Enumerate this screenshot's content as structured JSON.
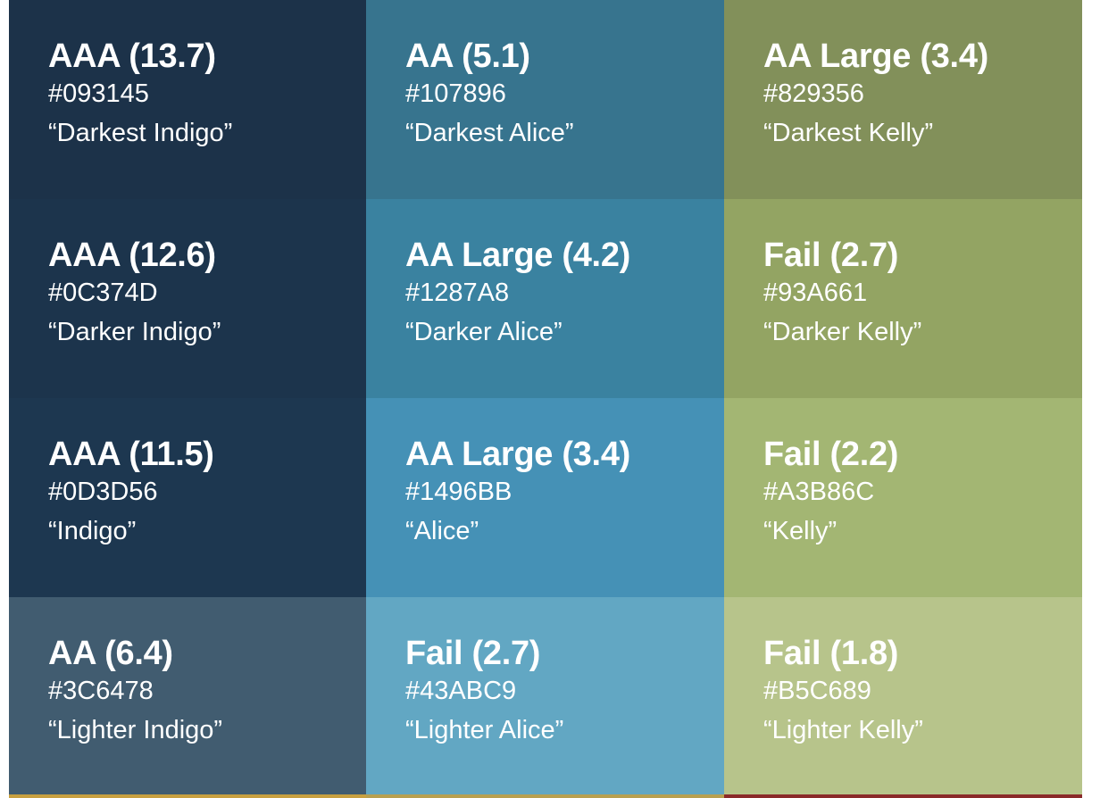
{
  "columns": [
    {
      "key": "indigo",
      "swatches": [
        {
          "rating": "AAA (13.7)",
          "hex": "#093145",
          "name": "“Darkest Indigo”",
          "bg": "#1C3249"
        },
        {
          "rating": "AAA (12.6)",
          "hex": "#0C374D",
          "name": "“Darker Indigo”",
          "bg": "#1C344C"
        },
        {
          "rating": "AAA (11.5)",
          "hex": "#0D3D56",
          "name": "“Indigo”",
          "bg": "#1D3750"
        },
        {
          "rating": "AA (6.4)",
          "hex": "#3C6478",
          "name": "“Lighter Indigo”",
          "bg": "#415C70"
        }
      ]
    },
    {
      "key": "alice",
      "swatches": [
        {
          "rating": "AA (5.1)",
          "hex": "#107896",
          "name": "“Darkest Alice”",
          "bg": "#37748E"
        },
        {
          "rating": "AA Large (4.2)",
          "hex": "#1287A8",
          "name": "“Darker Alice”",
          "bg": "#3A82A0"
        },
        {
          "rating": "AA Large (3.4)",
          "hex": "#1496BB",
          "name": "“Alice”",
          "bg": "#4591B6"
        },
        {
          "rating": "Fail (2.7)",
          "hex": "#43ABC9",
          "name": "“Lighter Alice”",
          "bg": "#62A7C3"
        }
      ]
    },
    {
      "key": "kelly",
      "swatches": [
        {
          "rating": "AA Large (3.4)",
          "hex": "#829356",
          "name": "“Darkest Kelly”",
          "bg": "#82905A"
        },
        {
          "rating": "Fail (2.7)",
          "hex": "#93A661",
          "name": "“Darker Kelly”",
          "bg": "#93A463"
        },
        {
          "rating": "Fail (2.2)",
          "hex": "#A3B86C",
          "name": "“Kelly”",
          "bg": "#A3B673"
        },
        {
          "rating": "Fail (1.8)",
          "hex": "#B5C689",
          "name": "“Lighter Kelly”",
          "bg": "#B7C48B"
        }
      ]
    }
  ],
  "bottom_strip_colors": [
    "#C8A040",
    "#B8A050",
    "#8A2A2A"
  ]
}
